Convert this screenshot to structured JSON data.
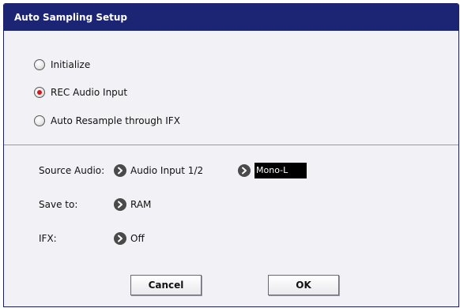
{
  "dialog": {
    "title": "Auto Sampling Setup"
  },
  "mode_options": [
    {
      "label": "Initialize",
      "selected": false
    },
    {
      "label": "REC Audio Input",
      "selected": true
    },
    {
      "label": "Auto Resample through IFX",
      "selected": false
    }
  ],
  "source_audio": {
    "label": "Source Audio:",
    "input_value": "Audio Input 1/2",
    "channel_value": "Mono-L"
  },
  "save_to": {
    "label": "Save to:",
    "value": "RAM"
  },
  "ifx": {
    "label": "IFX:",
    "value": "Off"
  },
  "buttons": {
    "cancel": "Cancel",
    "ok": "OK"
  },
  "colors": {
    "titlebar": "#1b2574",
    "radio_selected_dot": "#cc1b1b",
    "dialog_bg": "#f2f2f6"
  },
  "icons": {
    "popup_arrow": "chevron-right-icon"
  }
}
